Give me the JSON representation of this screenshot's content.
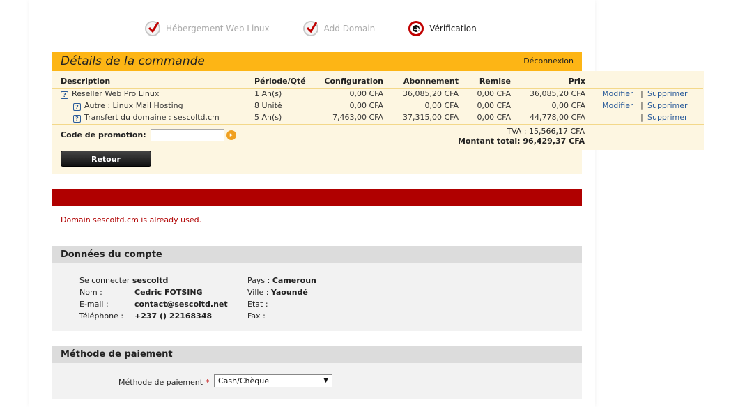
{
  "steps": [
    {
      "label": "Hébergement Web Linux"
    },
    {
      "label": "Add Domain"
    },
    {
      "label": "Vérification"
    }
  ],
  "header": {
    "title": "Détails de la commande",
    "logout": "Déconnexion"
  },
  "cart": {
    "columns": [
      "Description",
      "Période/Qté",
      "Configuration",
      "Abonnement",
      "Remise",
      "Prix"
    ],
    "rows": [
      {
        "desc": "Reseller Web Pro Linux",
        "period": "1 An(s)",
        "config": "0,00 CFA",
        "abo": "36,085,20 CFA",
        "remise": "0,00 CFA",
        "prix": "36,085,20 CFA",
        "modify": "Modifier",
        "sep": "|",
        "delete": "Supprimer"
      },
      {
        "desc": "Autre : Linux Mail Hosting",
        "period": "8 Unité",
        "config": "0,00 CFA",
        "abo": "0,00 CFA",
        "remise": "0,00 CFA",
        "prix": "0,00 CFA",
        "modify": "Modifier",
        "sep": "|",
        "delete": "Supprimer"
      },
      {
        "desc": "Transfert du domaine : sescoltd.cm",
        "period": "5 An(s)",
        "config": "7,463,00 CFA",
        "abo": "37,315,00 CFA",
        "remise": "0,00 CFA",
        "prix": "44,778,00 CFA",
        "modify": "",
        "sep": "|",
        "delete": "Supprimer"
      }
    ],
    "promo_label": "Code de promotion:",
    "tva": "TVA : 15,566,17 CFA",
    "total": "Montant total: 96,429,37 CFA",
    "back": "Retour"
  },
  "error": "Domain sescoltd.cm is already used.",
  "account": {
    "title": "Données du compte",
    "login_label": "Se connecter",
    "login": "sescoltd",
    "name_label": "Nom :",
    "name": "Cedric FOTSING",
    "email_label": "E-mail :",
    "email": "contact@sescoltd.net",
    "phone_label": "Téléphone :",
    "phone": "+237 () 22168348",
    "country_label": "Pays :",
    "country": "Cameroun",
    "city_label": "Ville :",
    "city": "Yaoundé",
    "state_label": "Etat :",
    "state": "",
    "fax_label": "Fax :",
    "fax": ""
  },
  "payment": {
    "title": "Méthode de paiement",
    "label": "Méthode de paiement",
    "required": "*",
    "selected": "Cash/Chèque"
  }
}
